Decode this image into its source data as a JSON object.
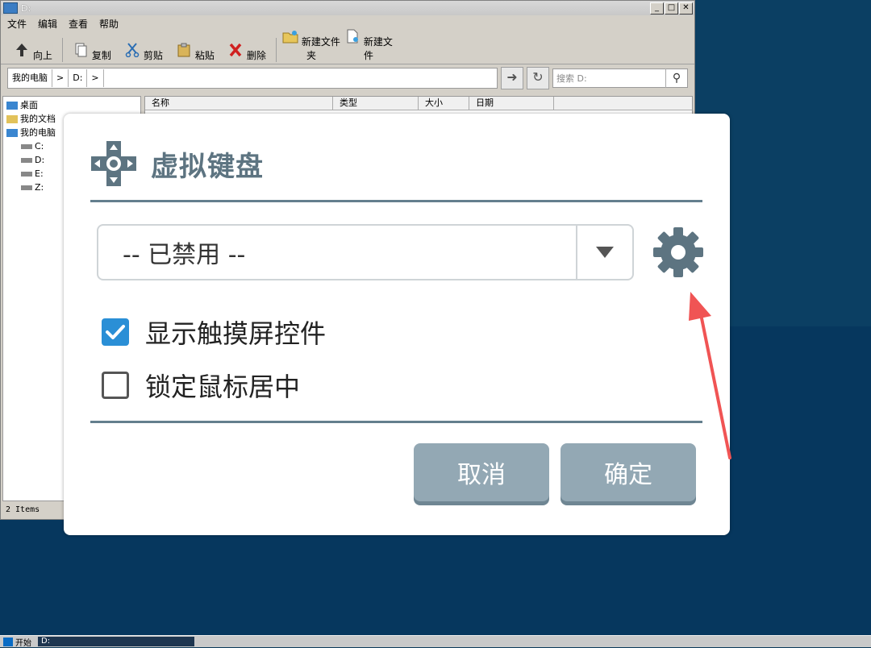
{
  "explorer": {
    "title": "D:",
    "menu": [
      "文件",
      "编辑",
      "查看",
      "帮助"
    ],
    "toolbar": [
      "向上",
      "复制",
      "剪贴",
      "粘贴",
      "删除",
      "新建文件夹",
      "新建文件"
    ],
    "address": {
      "crumbs": [
        "我的电脑",
        ">",
        "D:",
        ">"
      ]
    },
    "search_placeholder": "搜索 D:",
    "tree": [
      "桌面",
      "我的文档",
      "我的电脑",
      "C:",
      "D:",
      "E:",
      "Z:"
    ],
    "columns": [
      "名称",
      "类型",
      "大小",
      "日期"
    ],
    "status": "2 Items"
  },
  "taskbar": {
    "start_label": "开始",
    "task": "D:"
  },
  "dialog": {
    "title": "虚拟键盘",
    "select_value": "-- 已禁用 --",
    "checkboxes": [
      {
        "label": "显示触摸屏控件",
        "checked": true
      },
      {
        "label": "锁定鼠标居中",
        "checked": false
      }
    ],
    "cancel_label": "取消",
    "ok_label": "确定"
  },
  "colors": {
    "accent": "#2a8fd6",
    "title": "#5d7481",
    "button": "#93a8b4",
    "annotation": "#f05454"
  }
}
